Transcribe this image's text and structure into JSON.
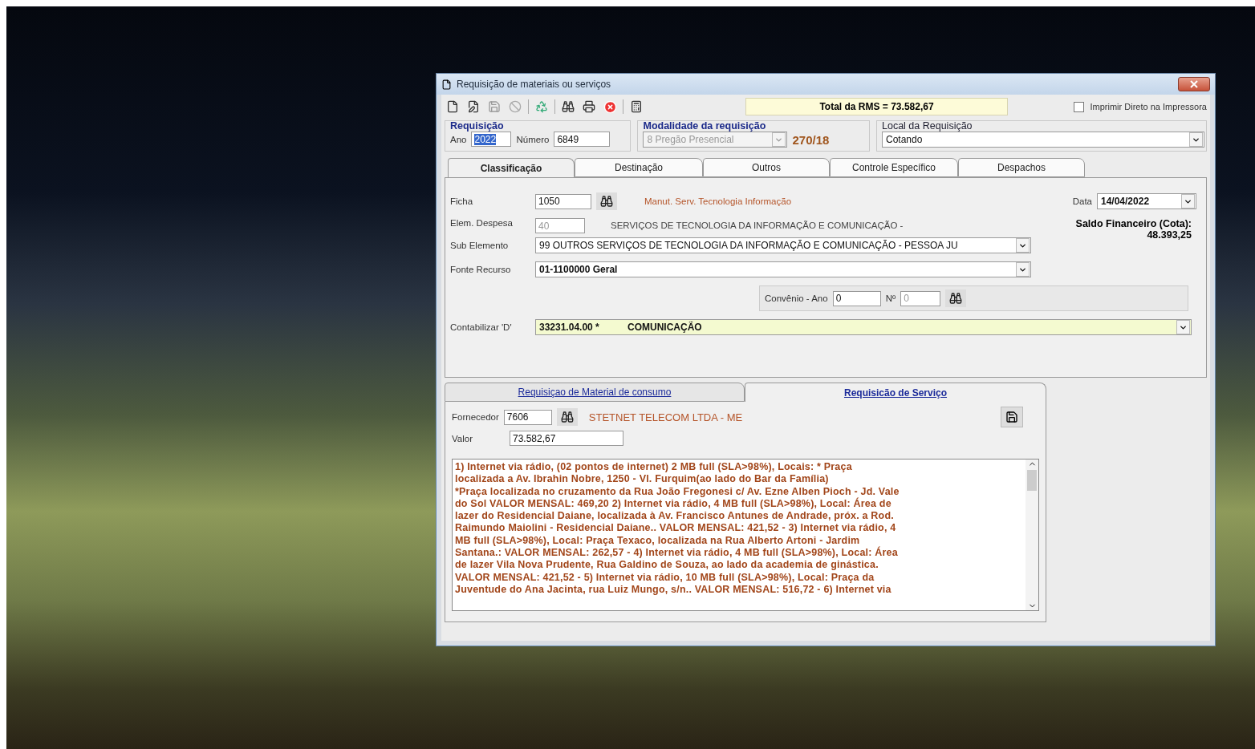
{
  "window": {
    "title": "Requisição de materiais ou serviços"
  },
  "toolbar": {
    "total": "Total da RMS = 73.582,67",
    "print_direct": {
      "label": "Imprimir Direto na Impressora",
      "checked": false
    }
  },
  "requisicao": {
    "title": "Requisição",
    "ano_label": "Ano",
    "ano_value": "2022",
    "numero_label": "Número",
    "numero_value": "6849"
  },
  "modalidade": {
    "title": "Modalidade da requisição",
    "value": "8 Pregão Presencial",
    "disabled": true,
    "code": "270/18"
  },
  "local": {
    "title": "Local da Requisição",
    "value": "Cotando"
  },
  "tabs": [
    {
      "label": "Classificação",
      "selected": true
    },
    {
      "label": "Destinação",
      "selected": false
    },
    {
      "label": "Outros",
      "selected": false
    },
    {
      "label": "Controle Específico",
      "selected": false
    },
    {
      "label": "Despachos",
      "selected": false
    }
  ],
  "classificacao": {
    "ficha_label": "Ficha",
    "ficha_value": "1050",
    "ficha_desc": "Manut. Serv. Tecnologia Informação",
    "data_label": "Data",
    "data_value": "14/04/2022",
    "elem_label": "Elem. Despesa",
    "elem_value": "40",
    "elem_desc": "SERVIÇOS DE TECNOLOGIA DA INFORMAÇÃO E COMUNICAÇÃO -",
    "saldo_label": "Saldo Financeiro (Cota):",
    "saldo_value": "48.393,25",
    "sub_label": "Sub Elemento",
    "sub_value": "99 OUTROS SERVIÇOS DE TECNOLOGIA DA INFORMAÇÃO E COMUNICAÇÃO - PESSOA JU",
    "fonte_label": "Fonte Recurso",
    "fonte_value": "01-1100000 Geral",
    "convenio_label": "Convênio - Ano",
    "convenio_value": "0",
    "numero_label": "Nº",
    "numero_value": "0",
    "contabilizar_label": "Contabilizar 'D'",
    "contabilizar_code": "33231.04.00 *",
    "contabilizar_value": "COMUNICAÇÃO"
  },
  "subtabs": [
    {
      "label": "Requisiçao de Material de consumo",
      "selected": false
    },
    {
      "label": "Requisicão de Serviço",
      "selected": true
    }
  ],
  "servico": {
    "fornecedor_label": "Fornecedor",
    "fornecedor_code": "7606",
    "fornecedor_name": "STETNET TELECOM LTDA - ME",
    "valor_label": "Valor",
    "valor_value": "73.582,67",
    "description": [
      "1) Internet via rádio,  (02 pontos de internet) 2 MB full (SLA>98%),  Locais: * Praça",
      "localizada a Av. Ibrahin Nobre, 1250 - Vl. Furquim(ao lado do Bar da Família)",
      "*Praça localizada no cruzamento da Rua João Fregonesi c/ Av. Ezne Alben Pioch - Jd. Vale",
      "do Sol VALOR MENSAL: 469,20  2) Internet via rádio, 4 MB full (SLA>98%),  Local: Área de",
      "lazer do Residencial Daiane, localizada à Av. Francisco Antunes de Andrade, próx. a Rod.",
      "Raimundo Maiolini - Residencial Daiane.. VALOR MENSAL: 421,52 -  3) Internet via rádio, 4",
      "MB full (SLA>98%),  Local: Praça Texaco, localizada na Rua Alberto Artoni - Jardim",
      "Santana.: VALOR MENSAL: 262,57 -  4) Internet via rádio, 4 MB full (SLA>98%),  Local: Área",
      "de lazer Vila Nova Prudente, Rua Galdino de Souza, ao lado da academia de ginástica.",
      "VALOR MENSAL: 421,52 -  5) Internet via rádio, 10 MB full (SLA>98%),  Local: Praça da",
      "Juventude do Ana Jacinta, rua Luiz Mungo, s/n.. VALOR MENSAL: 516,72 -  6) Internet via"
    ]
  }
}
